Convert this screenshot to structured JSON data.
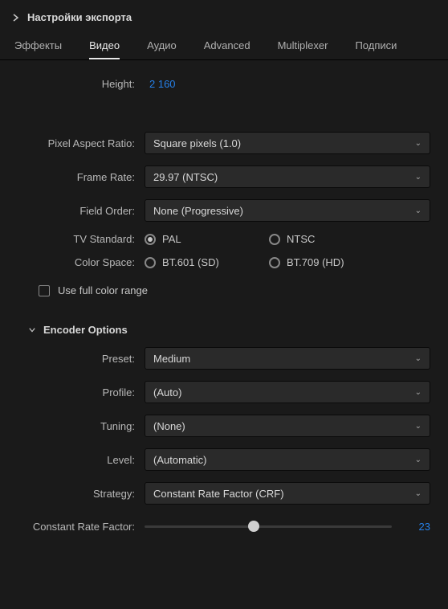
{
  "header": {
    "title": "Настройки экспорта"
  },
  "tabs": [
    "Эффекты",
    "Видео",
    "Аудио",
    "Advanced",
    "Multiplexer",
    "Подписи"
  ],
  "activeTabIndex": 1,
  "videoSettings": {
    "heightLabel": "Height:",
    "heightValue": "2 160",
    "pixelAspect": {
      "label": "Pixel Aspect Ratio:",
      "value": "Square pixels (1.0)"
    },
    "frameRate": {
      "label": "Frame Rate:",
      "value": "29.97 (NTSC)"
    },
    "fieldOrder": {
      "label": "Field Order:",
      "value": "None (Progressive)"
    },
    "tvStandard": {
      "label": "TV Standard:",
      "options": [
        "PAL",
        "NTSC"
      ],
      "selectedIndex": 0
    },
    "colorSpace": {
      "label": "Color Space:",
      "options": [
        "BT.601 (SD)",
        "BT.709 (HD)"
      ],
      "selectedIndex": -1
    },
    "fullColorRange": {
      "label": "Use full color range",
      "checked": false
    }
  },
  "encoder": {
    "header": "Encoder Options",
    "preset": {
      "label": "Preset:",
      "value": "Medium"
    },
    "profile": {
      "label": "Profile:",
      "value": "(Auto)"
    },
    "tuning": {
      "label": "Tuning:",
      "value": "(None)"
    },
    "level": {
      "label": "Level:",
      "value": "(Automatic)"
    },
    "strategy": {
      "label": "Strategy:",
      "value": "Constant Rate Factor (CRF)"
    },
    "crf": {
      "label": "Constant Rate Factor:",
      "value": "23"
    }
  }
}
